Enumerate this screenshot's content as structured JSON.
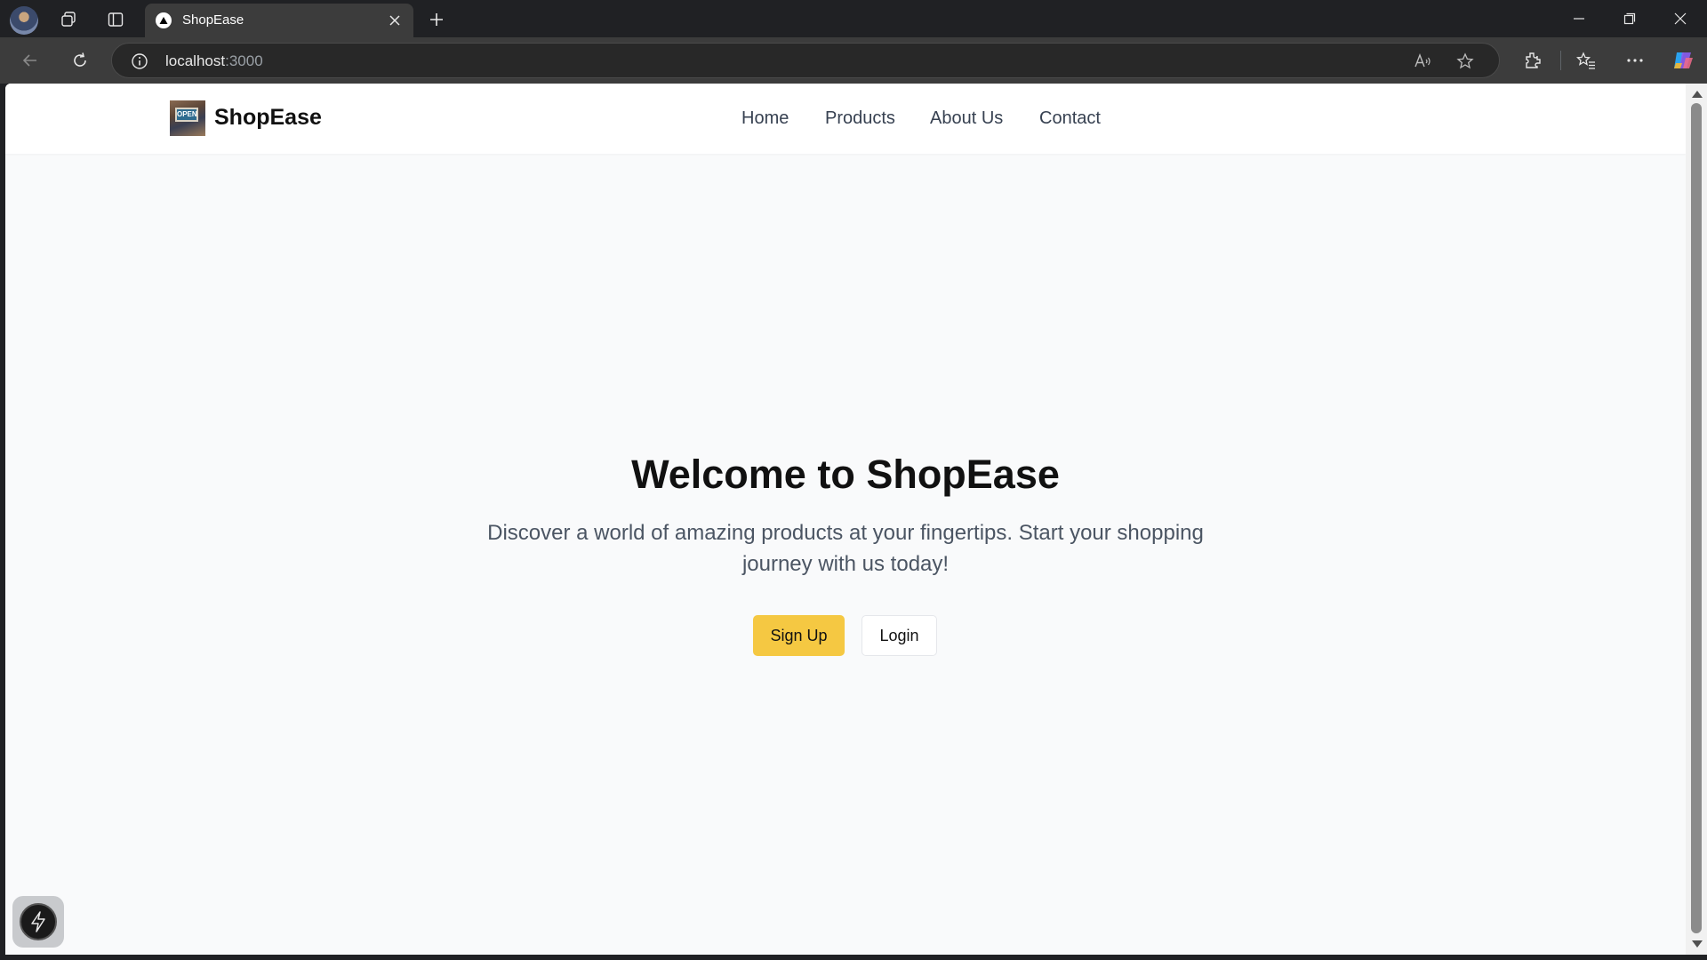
{
  "browser": {
    "tab_title": "ShopEase",
    "url_host": "localhost",
    "url_port": ":3000",
    "icons": {
      "profile": "profile-avatar",
      "workspaces": "workspaces-icon",
      "tab_actions": "vertical-tabs-icon",
      "favicon": "triangle-favicon-icon",
      "close_tab": "close-icon",
      "new_tab": "plus-icon",
      "back": "back-arrow-icon",
      "refresh": "refresh-icon",
      "site_info": "info-icon",
      "read_aloud": "read-aloud-icon",
      "favorite": "star-icon",
      "extensions": "extensions-icon",
      "favorites_bar": "favorites-icon",
      "menu": "more-icon",
      "copilot": "copilot-icon"
    }
  },
  "site": {
    "brand": "ShopEase",
    "logo_sign_text": "OPEN",
    "nav": [
      {
        "label": "Home"
      },
      {
        "label": "Products"
      },
      {
        "label": "About Us"
      },
      {
        "label": "Contact"
      }
    ]
  },
  "hero": {
    "title": "Welcome to ShopEase",
    "subtitle": "Discover a world of amazing products at your fingertips. Start your shopping journey with us today!",
    "signup_label": "Sign Up",
    "login_label": "Login"
  },
  "colors": {
    "accent": "#f5c842",
    "page_bg": "#f9fafb",
    "chrome_bg": "#202124"
  }
}
